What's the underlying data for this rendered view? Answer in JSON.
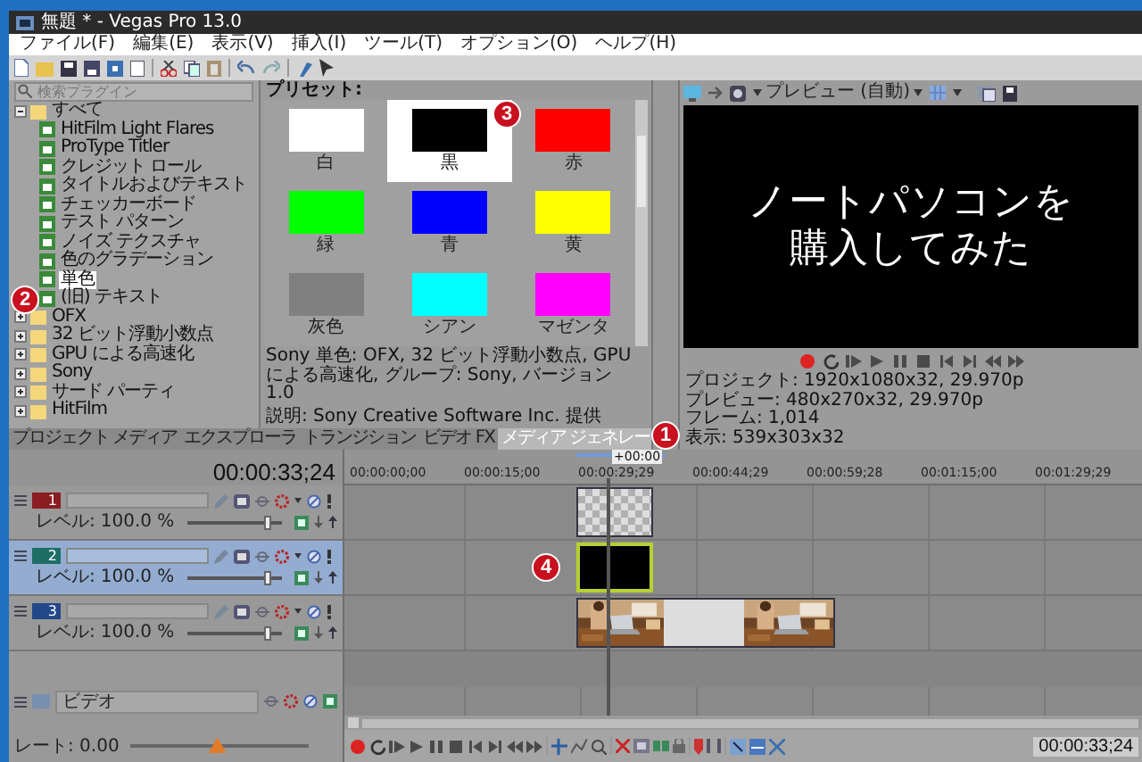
{
  "window": {
    "title": "無題 * - Vegas Pro 13.0"
  },
  "menu": [
    "ファイル(F)",
    "編集(E)",
    "表示(V)",
    "挿入(I)",
    "ツール(T)",
    "オプション(O)",
    "ヘルプ(H)"
  ],
  "plugin_tree": {
    "search": {
      "placeholder": "検索プラグイン"
    },
    "items": [
      {
        "label": "すべて",
        "kind": "folder",
        "expanded": true,
        "selected": false,
        "children": [
          {
            "label": "HitFilm Light Flares",
            "kind": "plugin",
            "selected": false
          },
          {
            "label": "ProType Titler",
            "kind": "plugin",
            "selected": false
          },
          {
            "label": "クレジット ロール",
            "kind": "plugin",
            "selected": false
          },
          {
            "label": "タイトルおよびテキスト",
            "kind": "plugin",
            "selected": false
          },
          {
            "label": "チェッカーボード",
            "kind": "plugin",
            "selected": false
          },
          {
            "label": "テスト パターン",
            "kind": "plugin",
            "selected": false
          },
          {
            "label": "ノイズ テクスチャ",
            "kind": "plugin",
            "selected": false
          },
          {
            "label": "色のグラデーション",
            "kind": "plugin",
            "selected": false
          },
          {
            "label": "単色",
            "kind": "plugin",
            "selected": true
          },
          {
            "label": "(旧) テキスト",
            "kind": "plugin",
            "selected": false
          }
        ]
      },
      {
        "label": "OFX",
        "kind": "folder",
        "expanded": false,
        "selected": false
      },
      {
        "label": "32 ビット浮動小数点",
        "kind": "folder",
        "expanded": false,
        "selected": false
      },
      {
        "label": "GPU による高速化",
        "kind": "folder",
        "expanded": false,
        "selected": false
      },
      {
        "label": "Sony",
        "kind": "folder",
        "expanded": false,
        "selected": false
      },
      {
        "label": "サード パーティ",
        "kind": "folder",
        "expanded": false,
        "selected": false
      },
      {
        "label": "HitFilm",
        "kind": "folder",
        "expanded": false,
        "selected": false
      }
    ]
  },
  "presets": {
    "label": "プリセット:",
    "items": [
      {
        "label": "白",
        "color": "#ffffff",
        "selected": false
      },
      {
        "label": "黒",
        "color": "#000000",
        "selected": true
      },
      {
        "label": "赤",
        "color": "#ff0000",
        "selected": false
      },
      {
        "label": "緑",
        "color": "#00ff00",
        "selected": false
      },
      {
        "label": "青",
        "color": "#0000ff",
        "selected": false
      },
      {
        "label": "黄",
        "color": "#ffff00",
        "selected": false
      },
      {
        "label": "灰色",
        "color": "#808080",
        "selected": false
      },
      {
        "label": "シアン",
        "color": "#00ffff",
        "selected": false
      },
      {
        "label": "マゼンタ",
        "color": "#ff00ff",
        "selected": false
      }
    ],
    "info": [
      "Sony 単色: OFX, 32 ビット浮動小数点, GPU による高速化, グループ: Sony, バージョン 1.0",
      "説明: Sony Creative Software Inc. 提供"
    ]
  },
  "dock_tabs": [
    {
      "label": "プロジェクト メディア",
      "selected": false
    },
    {
      "label": "エクスプローラ",
      "selected": false
    },
    {
      "label": "トランジション",
      "selected": false
    },
    {
      "label": "ビデオ FX",
      "selected": false
    },
    {
      "label": "メディア ジェネレー",
      "selected": true
    }
  ],
  "preview": {
    "mode": "プレビュー (自動)",
    "overlay_text": [
      "ノートパソコンを",
      "購入してみた"
    ],
    "info": [
      "プロジェクト: 1920x1080x32, 29.970p",
      "プレビュー: 480x270x32, 29.970p",
      "フレーム: 1,014",
      "表示: 539x303x32"
    ]
  },
  "timeline": {
    "timecode": "00:00:33;24",
    "marker": "+00:00",
    "ruler": [
      "00:00:00;00",
      "00:00:15;00",
      "00:00:29;29",
      "00:00:44;29",
      "00:00:59;28",
      "00:01:15;00",
      "00:01:29;29"
    ],
    "tracks": [
      {
        "number": "1",
        "color": "#8a1c22",
        "level_label": "レベル:",
        "level_value": "100.0 %",
        "level": 0.85,
        "selected": false,
        "clip": {
          "kind": "checker",
          "selected": false
        }
      },
      {
        "number": "2",
        "color": "#1e6e66",
        "level_label": "レベル:",
        "level_value": "100.0 %",
        "level": 0.85,
        "selected": true,
        "clip": {
          "kind": "black",
          "selected": true
        }
      },
      {
        "number": "3",
        "color": "#23488a",
        "level_label": "レベル:",
        "level_value": "100.0 %",
        "level": 0.85,
        "selected": false,
        "clip": {
          "kind": "video",
          "selected": false
        }
      }
    ],
    "bus": {
      "label": "ビデオ"
    },
    "rate": "レート: 0.00",
    "transport_timecode": "00:00:33;24"
  },
  "annotations": [
    {
      "label": "1"
    },
    {
      "label": "2"
    },
    {
      "label": "3"
    },
    {
      "label": "4"
    }
  ]
}
